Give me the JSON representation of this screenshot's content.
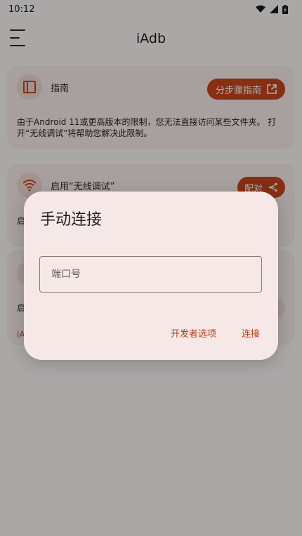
{
  "status_bar": {
    "time": "10:12"
  },
  "app_bar": {
    "title": "iAdb"
  },
  "cards": {
    "guide": {
      "title": "指南",
      "button": "分步骤指南",
      "body": "由于Android 11或更高版本的限制，您无法直接访问某些文件夹。 打开“无线调试”将帮助您解决此限制。"
    },
    "wireless": {
      "title": "启用“无线调试”",
      "button": "配对",
      "body_clip": "启"
    },
    "third": {
      "body_clip": "启",
      "red_clip": "iA"
    }
  },
  "dialog": {
    "title": "手动连接",
    "port_placeholder": "端口号",
    "developer_options": "开发者选项",
    "connect": "连接"
  },
  "colors": {
    "accent": "#c8441c",
    "dialog_bg": "#f5e8e6",
    "card_bg": "#f6ecea"
  }
}
